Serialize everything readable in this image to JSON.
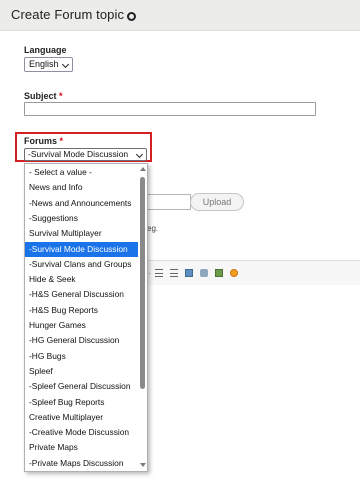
{
  "page": {
    "title": "Create Forum topic"
  },
  "language": {
    "label": "Language",
    "value": "English"
  },
  "subject": {
    "label": "Subject",
    "required_mark": "*",
    "value": ""
  },
  "forums": {
    "label": "Forums",
    "required_mark": "*",
    "value": "-Survival Mode Discussion",
    "options": [
      "- Select a value -",
      "News and Info",
      "-News and Announcements",
      "-Suggestions",
      "Survival Multiplayer",
      "-Survival Mode Discussion",
      "-Survival Clans and Groups",
      "Hide & Seek",
      "-H&S General Discussion",
      "-H&S Bug Reports",
      "Hunger Games",
      "-HG General Discussion",
      "-HG Bugs",
      "Spleef",
      "-Spleef General Discussion",
      "-Spleef Bug Reports",
      "Creative Multiplayer",
      "-Creative Mode Discussion",
      "Private Maps",
      "-Private Maps Discussion"
    ],
    "selected_option": "-Survival Mode Discussion"
  },
  "upload": {
    "button_label": "Upload",
    "hint_visible": "eg."
  },
  "editor": {
    "toolbar_icons": [
      "separator",
      "numbered-list-icon",
      "bulleted-list-icon",
      "image-icon",
      "anchor-icon",
      "picture-icon",
      "smiley-icon"
    ]
  },
  "colors": {
    "highlight_border": "#d32020",
    "selected_option_bg": "#1a73e8",
    "required_mark": "#e0001b"
  }
}
